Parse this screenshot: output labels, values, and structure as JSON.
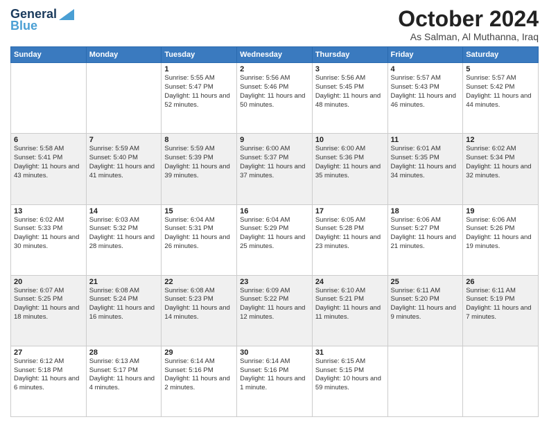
{
  "header": {
    "logo_line1": "General",
    "logo_line2": "Blue",
    "month_title": "October 2024",
    "location": "As Salman, Al Muthanna, Iraq"
  },
  "weekdays": [
    "Sunday",
    "Monday",
    "Tuesday",
    "Wednesday",
    "Thursday",
    "Friday",
    "Saturday"
  ],
  "weeks": [
    [
      {
        "day": "",
        "detail": ""
      },
      {
        "day": "",
        "detail": ""
      },
      {
        "day": "1",
        "detail": "Sunrise: 5:55 AM\nSunset: 5:47 PM\nDaylight: 11 hours and 52 minutes."
      },
      {
        "day": "2",
        "detail": "Sunrise: 5:56 AM\nSunset: 5:46 PM\nDaylight: 11 hours and 50 minutes."
      },
      {
        "day": "3",
        "detail": "Sunrise: 5:56 AM\nSunset: 5:45 PM\nDaylight: 11 hours and 48 minutes."
      },
      {
        "day": "4",
        "detail": "Sunrise: 5:57 AM\nSunset: 5:43 PM\nDaylight: 11 hours and 46 minutes."
      },
      {
        "day": "5",
        "detail": "Sunrise: 5:57 AM\nSunset: 5:42 PM\nDaylight: 11 hours and 44 minutes."
      }
    ],
    [
      {
        "day": "6",
        "detail": "Sunrise: 5:58 AM\nSunset: 5:41 PM\nDaylight: 11 hours and 43 minutes."
      },
      {
        "day": "7",
        "detail": "Sunrise: 5:59 AM\nSunset: 5:40 PM\nDaylight: 11 hours and 41 minutes."
      },
      {
        "day": "8",
        "detail": "Sunrise: 5:59 AM\nSunset: 5:39 PM\nDaylight: 11 hours and 39 minutes."
      },
      {
        "day": "9",
        "detail": "Sunrise: 6:00 AM\nSunset: 5:37 PM\nDaylight: 11 hours and 37 minutes."
      },
      {
        "day": "10",
        "detail": "Sunrise: 6:00 AM\nSunset: 5:36 PM\nDaylight: 11 hours and 35 minutes."
      },
      {
        "day": "11",
        "detail": "Sunrise: 6:01 AM\nSunset: 5:35 PM\nDaylight: 11 hours and 34 minutes."
      },
      {
        "day": "12",
        "detail": "Sunrise: 6:02 AM\nSunset: 5:34 PM\nDaylight: 11 hours and 32 minutes."
      }
    ],
    [
      {
        "day": "13",
        "detail": "Sunrise: 6:02 AM\nSunset: 5:33 PM\nDaylight: 11 hours and 30 minutes."
      },
      {
        "day": "14",
        "detail": "Sunrise: 6:03 AM\nSunset: 5:32 PM\nDaylight: 11 hours and 28 minutes."
      },
      {
        "day": "15",
        "detail": "Sunrise: 6:04 AM\nSunset: 5:31 PM\nDaylight: 11 hours and 26 minutes."
      },
      {
        "day": "16",
        "detail": "Sunrise: 6:04 AM\nSunset: 5:29 PM\nDaylight: 11 hours and 25 minutes."
      },
      {
        "day": "17",
        "detail": "Sunrise: 6:05 AM\nSunset: 5:28 PM\nDaylight: 11 hours and 23 minutes."
      },
      {
        "day": "18",
        "detail": "Sunrise: 6:06 AM\nSunset: 5:27 PM\nDaylight: 11 hours and 21 minutes."
      },
      {
        "day": "19",
        "detail": "Sunrise: 6:06 AM\nSunset: 5:26 PM\nDaylight: 11 hours and 19 minutes."
      }
    ],
    [
      {
        "day": "20",
        "detail": "Sunrise: 6:07 AM\nSunset: 5:25 PM\nDaylight: 11 hours and 18 minutes."
      },
      {
        "day": "21",
        "detail": "Sunrise: 6:08 AM\nSunset: 5:24 PM\nDaylight: 11 hours and 16 minutes."
      },
      {
        "day": "22",
        "detail": "Sunrise: 6:08 AM\nSunset: 5:23 PM\nDaylight: 11 hours and 14 minutes."
      },
      {
        "day": "23",
        "detail": "Sunrise: 6:09 AM\nSunset: 5:22 PM\nDaylight: 11 hours and 12 minutes."
      },
      {
        "day": "24",
        "detail": "Sunrise: 6:10 AM\nSunset: 5:21 PM\nDaylight: 11 hours and 11 minutes."
      },
      {
        "day": "25",
        "detail": "Sunrise: 6:11 AM\nSunset: 5:20 PM\nDaylight: 11 hours and 9 minutes."
      },
      {
        "day": "26",
        "detail": "Sunrise: 6:11 AM\nSunset: 5:19 PM\nDaylight: 11 hours and 7 minutes."
      }
    ],
    [
      {
        "day": "27",
        "detail": "Sunrise: 6:12 AM\nSunset: 5:18 PM\nDaylight: 11 hours and 6 minutes."
      },
      {
        "day": "28",
        "detail": "Sunrise: 6:13 AM\nSunset: 5:17 PM\nDaylight: 11 hours and 4 minutes."
      },
      {
        "day": "29",
        "detail": "Sunrise: 6:14 AM\nSunset: 5:16 PM\nDaylight: 11 hours and 2 minutes."
      },
      {
        "day": "30",
        "detail": "Sunrise: 6:14 AM\nSunset: 5:16 PM\nDaylight: 11 hours and 1 minute."
      },
      {
        "day": "31",
        "detail": "Sunrise: 6:15 AM\nSunset: 5:15 PM\nDaylight: 10 hours and 59 minutes."
      },
      {
        "day": "",
        "detail": ""
      },
      {
        "day": "",
        "detail": ""
      }
    ]
  ]
}
